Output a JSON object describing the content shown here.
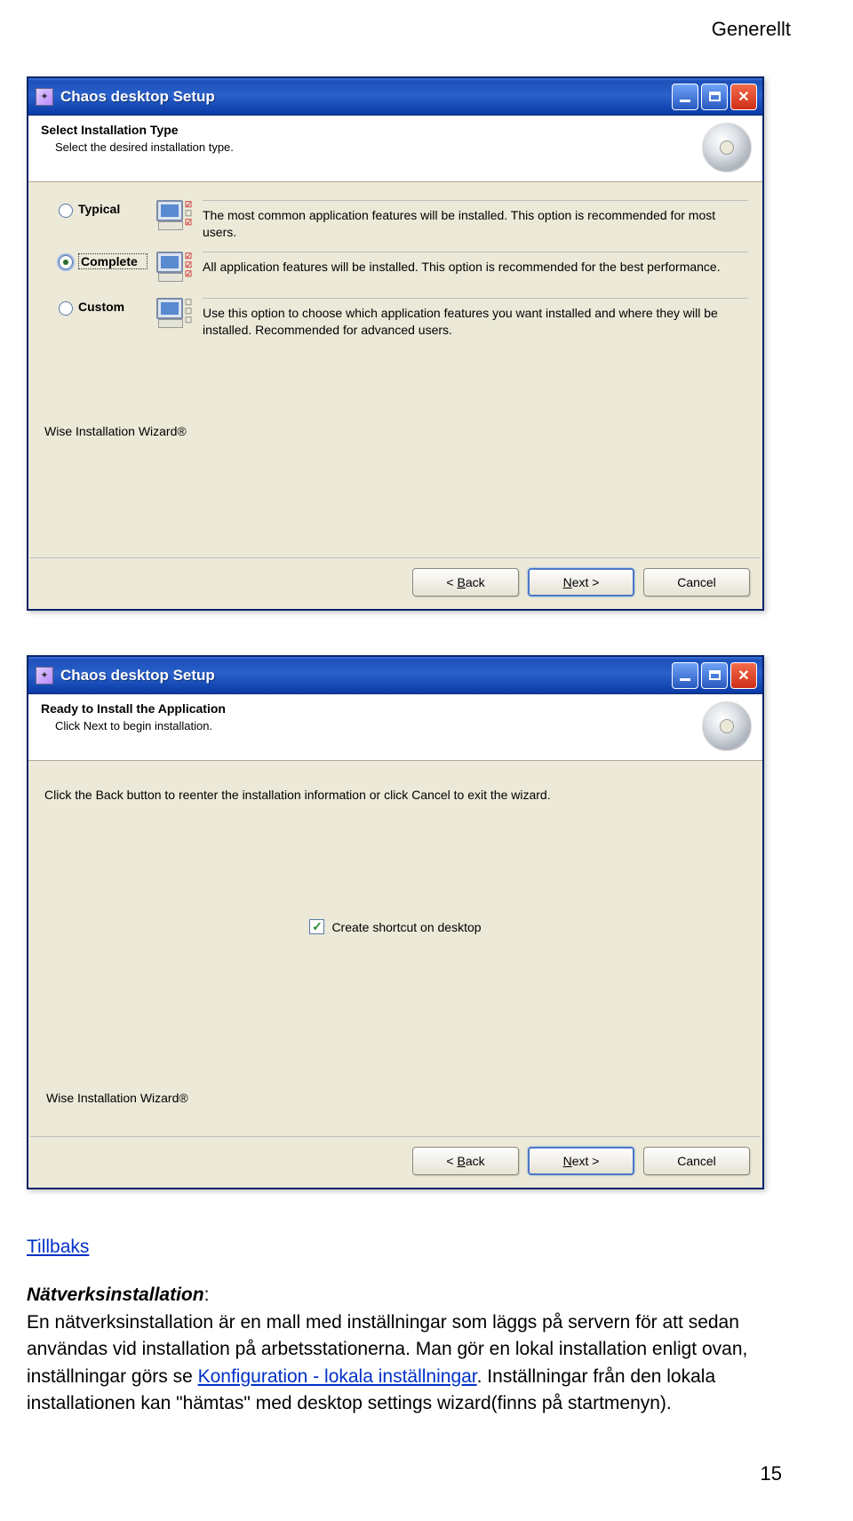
{
  "page": {
    "header": "Generellt",
    "pageNumber": "15"
  },
  "win1": {
    "title": "Chaos desktop Setup",
    "heading": "Select Installation Type",
    "subheading": "Select the desired installation type.",
    "options": {
      "typical": {
        "label": "Typical",
        "desc": "The most common application features will be installed. This option is recommended for most users."
      },
      "complete": {
        "label": "Complete",
        "desc": "All application features will be installed. This option is recommended for the best performance."
      },
      "custom": {
        "label": "Custom",
        "desc": "Use this option to choose which application features you want installed and where they will be installed. Recommended for advanced users."
      }
    },
    "brand": "Wise Installation Wizard®",
    "buttons": {
      "back": "< Back",
      "next": "Next >",
      "cancel": "Cancel"
    }
  },
  "win2": {
    "title": "Chaos desktop Setup",
    "heading": "Ready to Install the Application",
    "subheading": "Click Next to begin installation.",
    "note": "Click the Back button to reenter the installation information or click Cancel to exit the wizard.",
    "shortcut": "Create shortcut on desktop",
    "brand": "Wise Installation Wizard®",
    "buttons": {
      "back": "< Back",
      "next": "Next >",
      "cancel": "Cancel"
    }
  },
  "doc": {
    "tillbaks": "Tillbaks",
    "natHeading": "Nätverksinstallation",
    "p1": "En nätverksinstallation är en mall med inställningar som läggs på servern för att sedan användas vid installation på arbetsstationerna. Man gör en lokal installation enligt ovan, inställningar görs se ",
    "konfLink": "Konfiguration - lokala inställningar",
    "p2": ". Inställningar från den lokala installationen kan \"hämtas\" med desktop settings wizard(finns på startmenyn)."
  }
}
